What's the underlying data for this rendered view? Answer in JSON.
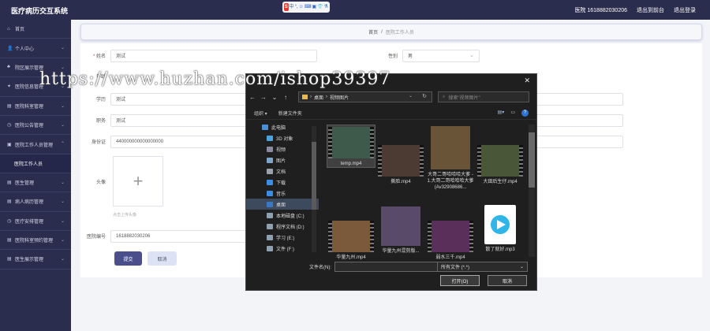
{
  "header": {
    "brand": "医疗病历交互系统",
    "user": "医院 1618882030206",
    "exit_admin": "退出到前台",
    "logout": "退出登录",
    "ime": {
      "s": "S",
      "items": [
        "中",
        "°,",
        "☺",
        "⌨",
        "▣",
        "👕",
        "⚗"
      ]
    }
  },
  "sidebar": {
    "items": [
      {
        "icon": "⌂",
        "label": "首页",
        "has_chevron": false
      },
      {
        "icon": "👤",
        "label": "个人中心",
        "has_chevron": true
      },
      {
        "icon": "♣",
        "label": "院区展示管理",
        "has_chevron": true
      },
      {
        "icon": "✦",
        "label": "医院信息管理",
        "has_chevron": true
      },
      {
        "icon": "▤",
        "label": "医院科室管理",
        "has_chevron": true
      },
      {
        "icon": "◷",
        "label": "医院公告管理",
        "has_chevron": true
      },
      {
        "icon": "▣",
        "label": "医院工作人员管理",
        "has_chevron": true
      }
    ],
    "sub_item": "医院工作人员",
    "items_after": [
      {
        "icon": "▤",
        "label": "医生管理",
        "has_chevron": true
      },
      {
        "icon": "▤",
        "label": "病人病历管理",
        "has_chevron": true
      },
      {
        "icon": "◷",
        "label": "医疗安排管理",
        "has_chevron": true
      },
      {
        "icon": "▤",
        "label": "医院科室预约管理",
        "has_chevron": true
      },
      {
        "icon": "▤",
        "label": "医生展示管理",
        "has_chevron": true
      }
    ]
  },
  "breadcrumb": {
    "home": "首页",
    "sep": "/",
    "current": "医院工作人员"
  },
  "form": {
    "name_label": "姓名",
    "name_value": "测试",
    "gender_label": "性别",
    "gender_value": "男",
    "age_label": "年龄",
    "education_label": "学历",
    "education_value": "测试",
    "position_label": "职务",
    "position_value": "测试",
    "id_label": "身份证",
    "id_value": "440000000000000000",
    "avatar_label": "头像",
    "upload_plus": "+",
    "upload_hint": "点击上传头像",
    "hospital_id_label": "医院编号",
    "hospital_id_value": "1618882030206",
    "submit": "提交",
    "cancel": "取消"
  },
  "watermark": "https://www.huzhan.com/ishop39397",
  "dialog": {
    "close": "✕",
    "back": "←",
    "forward": "→",
    "down": "⌄",
    "up": "↑",
    "path": [
      "桌面",
      "视频图片"
    ],
    "path_sep": "›",
    "refresh": "↻",
    "search_placeholder": "搜索\"视频图片\"",
    "organize": "组织 ▾",
    "new_folder": "新建文件夹",
    "help": "?",
    "tree": [
      {
        "label": "此电脑",
        "color": "#4a90d9",
        "selected": false
      },
      {
        "label": "3D 对象",
        "color": "#4aa3df",
        "selected": false
      },
      {
        "label": "视频",
        "color": "#8a8aa0",
        "selected": false
      },
      {
        "label": "图片",
        "color": "#7fa6c9",
        "selected": false
      },
      {
        "label": "文档",
        "color": "#9aa2ad",
        "selected": false
      },
      {
        "label": "下载",
        "color": "#3a8ee6",
        "selected": false
      },
      {
        "label": "音乐",
        "color": "#3a8ee6",
        "selected": false
      },
      {
        "label": "桌面",
        "color": "#3b78c4",
        "selected": true
      },
      {
        "label": "本地磁盘 (C:)",
        "color": "#8fa0b0",
        "selected": false
      },
      {
        "label": "程序文档 (D:)",
        "color": "#8fa0b0",
        "selected": false
      },
      {
        "label": "学习 (E:)",
        "color": "#8fa0b0",
        "selected": false
      },
      {
        "label": "文件 (F:)",
        "color": "#8fa0b0",
        "selected": false
      }
    ],
    "files": [
      {
        "name": "temp.mp4",
        "bg": "#3e5a4a",
        "selected": true,
        "kind": "video"
      },
      {
        "name": "撕脸.mp4",
        "bg": "#4b3b33",
        "selected": false,
        "kind": "video"
      },
      {
        "name": "大哥二哥哈哈哈大爹 - 1.大哥二哥哈哈哈大爹(Av32908686...",
        "bg": "#6a5438",
        "selected": false,
        "kind": "video-tall"
      },
      {
        "name": "大田后生仔.mp4",
        "bg": "#4a5638",
        "selected": false,
        "kind": "video"
      },
      {
        "name": "华量九州.mp4",
        "bg": "#7a5a3a",
        "selected": false,
        "kind": "video"
      },
      {
        "name": "华量九州混剪版...",
        "bg": "#5a4a6a",
        "selected": false,
        "kind": "video-tall"
      },
      {
        "name": "弱水三千.mp4",
        "bg": "#5a2f5a",
        "selected": false,
        "kind": "video"
      },
      {
        "name": "散了就好.mp3",
        "bg": "#ffffff",
        "selected": false,
        "kind": "audio"
      }
    ],
    "filename_label": "文件名(N):",
    "filetype": "所有文件 (*.*)",
    "open": "打开(O)",
    "cancel": "取消"
  }
}
